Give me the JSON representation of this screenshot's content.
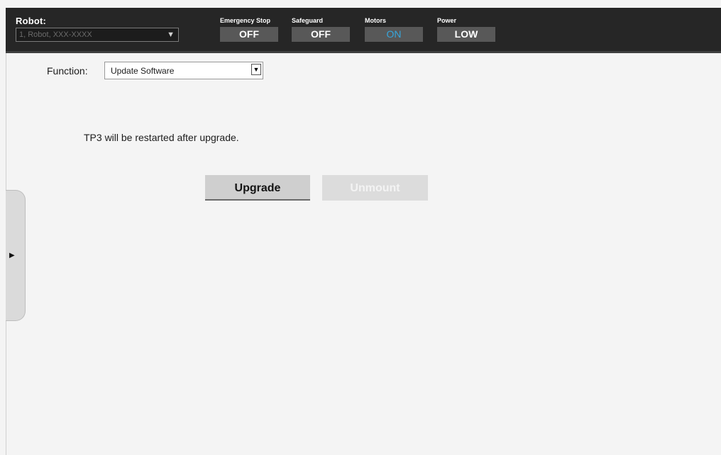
{
  "robot": {
    "label": "Robot:",
    "selected": "1, Robot, XXX-XXXX",
    "dropdown_icon": "triangle-down-icon"
  },
  "status": {
    "emergency_stop": {
      "label": "Emergency Stop",
      "value": "OFF"
    },
    "safeguard": {
      "label": "Safeguard",
      "value": "OFF"
    },
    "motors": {
      "label": "Motors",
      "value": "ON"
    },
    "power": {
      "label": "Power",
      "value": "LOW"
    }
  },
  "function": {
    "label": "Function:",
    "selected": "Update Software",
    "dropdown_icon": "triangle-down-icon"
  },
  "message": "TP3 will be restarted after upgrade.",
  "buttons": {
    "upgrade": "Upgrade",
    "unmount": "Unmount"
  },
  "side_panel": {
    "icon": "triangle-right-icon"
  },
  "colors": {
    "top_bar": "#262626",
    "status_box": "#585858",
    "motors_on": "#36a6dd",
    "background": "#f4f4f4"
  }
}
